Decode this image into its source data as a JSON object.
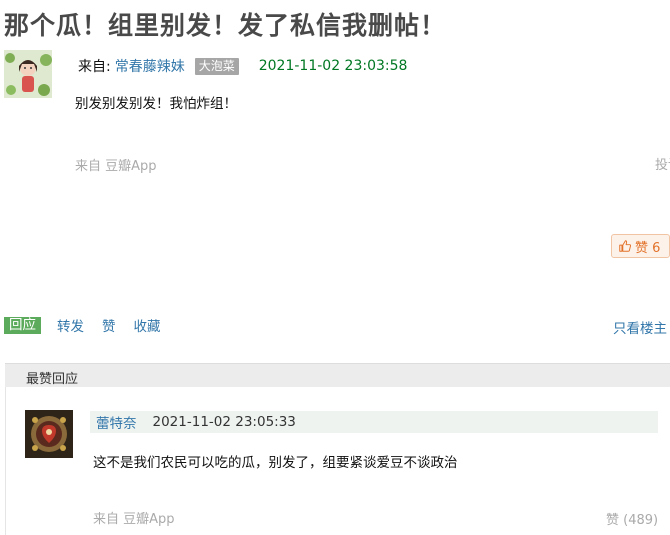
{
  "post": {
    "title": "那个瓜！组里别发！发了私信我删帖！",
    "from_label": "来自:",
    "author": "常春藤辣妹",
    "badge": "大泡菜",
    "time": "2021-11-02 23:03:58",
    "body": "别发别发别发！我怕炸组！",
    "source": "来自 豆瓣App",
    "report": "投诉",
    "like_label": "赞 6"
  },
  "actions": {
    "reply": "回应",
    "repost": "转发",
    "like": "赞",
    "collect": "收藏",
    "only_op": "只看楼主"
  },
  "section": {
    "title": "最赞回应"
  },
  "reply": {
    "author": "蕾特奈",
    "time": "2021-11-02 23:05:33",
    "text": "这不是我们农民可以吃的瓜，别发了，组要紧谈爱豆不谈政治",
    "source": "来自 豆瓣App",
    "likes": "赞 (489)"
  },
  "colors": {
    "link": "#3377aa",
    "time_green": "#007722",
    "reply_button": "#5cab5c",
    "like_orange": "#e2722a"
  }
}
